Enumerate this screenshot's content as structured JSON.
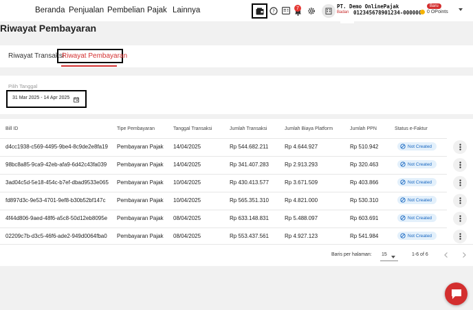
{
  "nav": {
    "items": [
      "Beranda",
      "Penjualan",
      "Pembelian",
      "Pajak",
      "Lainnya"
    ],
    "notification_count": "7",
    "company_name": "PT. Demo OnlinePajak",
    "company_label": "Badan",
    "company_npwp": "012345678901234-000000",
    "new_badge": "Baru",
    "points": "0 OPoints"
  },
  "page_title": "Riwayat Pembayaran",
  "tabs": [
    "Riwayat Transaksi",
    "Riwayat Pembayaran"
  ],
  "filter": {
    "label": "Pilih Tanggal",
    "date_range": "31 Mar 2025 - 14 Apr 2025"
  },
  "table": {
    "headers": [
      "Bill ID",
      "Tipe Pembayaran",
      "Tanggal Transaksi",
      "Jumlah Transaksi",
      "Jumlah Biaya Platform",
      "Jumlah PPN",
      "Status e-Faktur"
    ],
    "rows": [
      {
        "bill_id": "d4cc1938-c569-4495-9be4-8c9de2e8fa19",
        "type": "Pembayaran Pajak",
        "date": "14/04/2025",
        "amount": "Rp 544.682.211",
        "fee": "Rp 4.644.927",
        "ppn": "Rp 510.942",
        "status": "Not Created"
      },
      {
        "bill_id": "98bc8a85-9ca9-42eb-afa9-6d42c43fa039",
        "type": "Pembayaran Pajak",
        "date": "14/04/2025",
        "amount": "Rp 341.407.283",
        "fee": "Rp 2.913.293",
        "ppn": "Rp 320.463",
        "status": "Not Created"
      },
      {
        "bill_id": "3ad04c5d-5e18-454c-b7ef-dbad9533e065",
        "type": "Pembayaran Pajak",
        "date": "10/04/2025",
        "amount": "Rp 430.413.577",
        "fee": "Rp 3.671.509",
        "ppn": "Rp 403.866",
        "status": "Not Created"
      },
      {
        "bill_id": "fd897d3c-9e53-4701-9ef8-b30b52bf147c",
        "type": "Pembayaran Pajak",
        "date": "10/04/2025",
        "amount": "Rp 565.351.310",
        "fee": "Rp 4.821.000",
        "ppn": "Rp 530.310",
        "status": "Not Created"
      },
      {
        "bill_id": "4f44d806-9aed-48f6-a5c8-50d12eb8095e",
        "type": "Pembayaran Pajak",
        "date": "08/04/2025",
        "amount": "Rp 633.148.831",
        "fee": "Rp 5.488.097",
        "ppn": "Rp 603.691",
        "status": "Not Created"
      },
      {
        "bill_id": "02209c7b-d3c5-46f6-ade2-949d0064fba0",
        "type": "Pembayaran Pajak",
        "date": "08/04/2025",
        "amount": "Rp 553.437.561",
        "fee": "Rp 4.927.123",
        "ppn": "Rp 541.984",
        "status": "Not Created"
      }
    ]
  },
  "pagination": {
    "rows_per_page_label": "Baris per halaman:",
    "rows_per_page": "15",
    "range": "1-6 of 6"
  },
  "colors": {
    "accent": "#d32f2f",
    "status_bg": "#e3f0fb",
    "status_text": "#1565c0"
  }
}
